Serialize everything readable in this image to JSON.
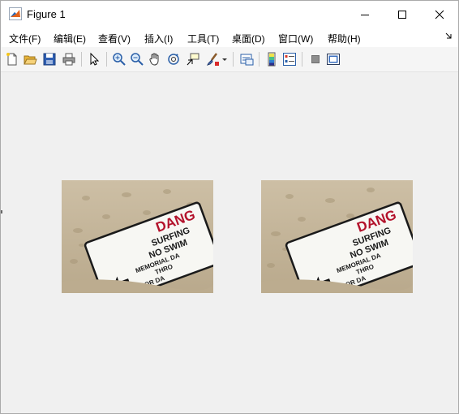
{
  "window": {
    "title": "Figure 1"
  },
  "menu": {
    "items": [
      "文件(F)",
      "编辑(E)",
      "查看(V)",
      "插入(I)",
      "工具(T)",
      "桌面(D)",
      "窗口(W)",
      "帮助(H)"
    ]
  },
  "images": {
    "left": {
      "sign_lines": [
        "DANG",
        "SURFING",
        "NO SWIM",
        "MEMORIAL DA",
        "THRO",
        "LABOR DA"
      ]
    },
    "right": {
      "sign_lines": [
        "DANG",
        "SURFING",
        "NO SWIM",
        "MEMORIAL DA",
        "THRO",
        "LABOR DA"
      ]
    }
  },
  "colors": {
    "sign_red": "#b3122b",
    "sand": "#cbbda4"
  }
}
